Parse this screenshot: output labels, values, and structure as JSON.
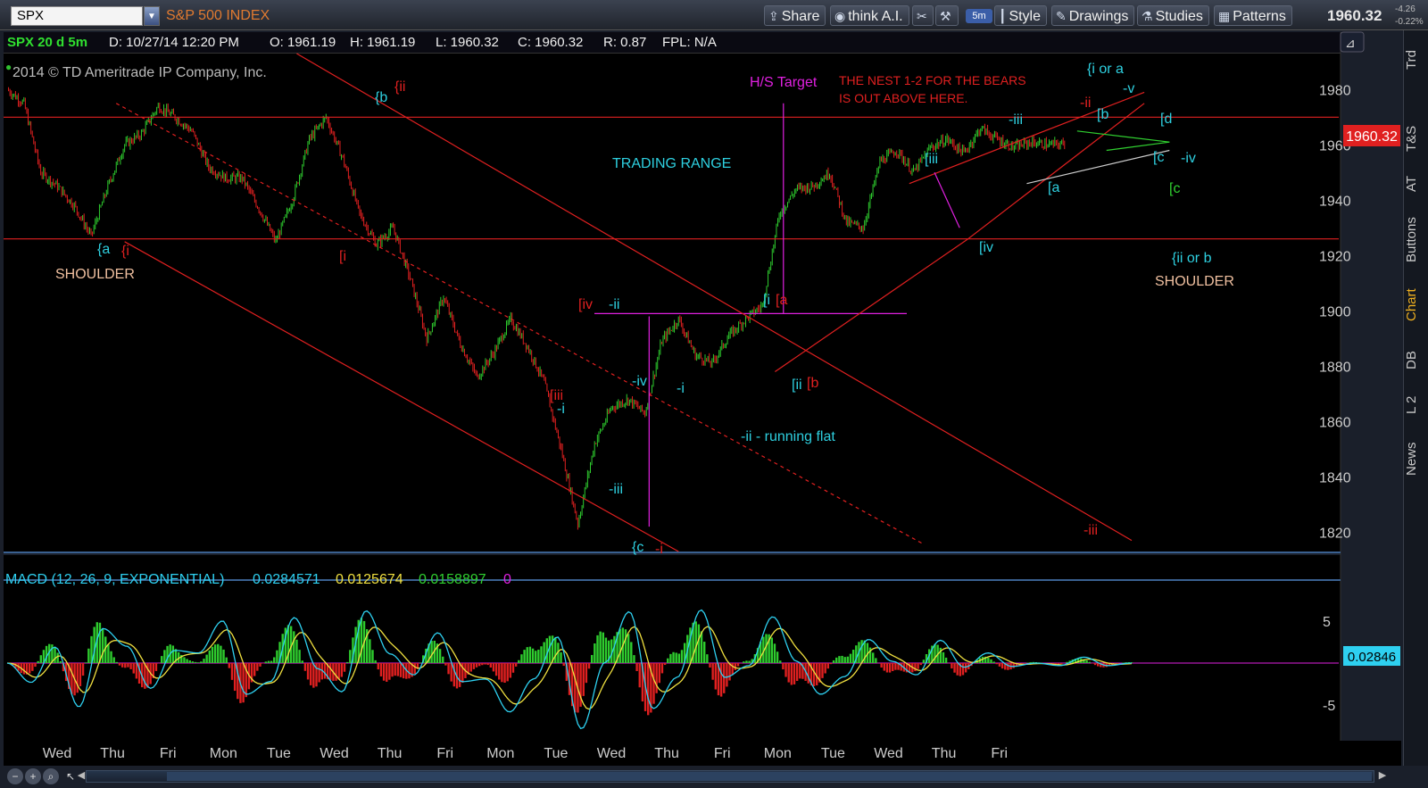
{
  "toolbar": {
    "symbol": "SPX",
    "index_name": "S&P 500 INDEX",
    "share": "Share",
    "think_ai": "think A.I.",
    "aggregation": "5m",
    "style": "Style",
    "drawings": "Drawings",
    "studies": "Studies",
    "patterns": "Patterns",
    "last_price": "1960.32",
    "net_change": "-4.26",
    "pct_change": "-0.22%"
  },
  "side_tabs": [
    "Trd",
    "T&S",
    "AT",
    "Buttons",
    "Chart",
    "DB",
    "L 2",
    "News"
  ],
  "info_bar": {
    "symbol": "SPX 20 d 5m",
    "date": "D: 10/27/14 12:20 PM",
    "open": "O: 1961.19",
    "high": "H: 1961.19",
    "low": "L: 1960.32",
    "close": "C: 1960.32",
    "range": "R: 0.87",
    "fpl": "FPL: N/A"
  },
  "copyright": "2014 © TD Ameritrade IP Company, Inc.",
  "colors": {
    "background": "#000000",
    "up": "#2ecc2e",
    "down": "#e02020",
    "annotation_cyan": "#2ed0e0",
    "annotation_red": "#e02020",
    "annotation_magenta": "#e020e0",
    "annotation_pink": "#f0c0a0",
    "macd_line": "#2ed0f0",
    "signal_line": "#f0e040",
    "price_badge": "#e02020"
  },
  "chart_data": [
    {
      "type": "candlestick",
      "title": "SPX 20 d 5m",
      "y_ticks": [
        1820,
        1840,
        1860,
        1880,
        1900,
        1920,
        1940,
        1960,
        1980
      ],
      "ylim": [
        1813,
        1993
      ],
      "last_value": "1960.32",
      "x_tick_labels": [
        "Wed",
        "Thu",
        "Fri",
        "Mon",
        "Tue",
        "Wed",
        "Thu",
        "Fri",
        "Mon",
        "Tue",
        "Wed",
        "Thu",
        "Fri",
        "Mon",
        "Tue",
        "Wed",
        "Thu",
        "Fri"
      ],
      "x": [
        0,
        4,
        8,
        12,
        16,
        20,
        24,
        28,
        32,
        36,
        40,
        44,
        48,
        52,
        56,
        60,
        64,
        68,
        72,
        76,
        80,
        84,
        88,
        92,
        96,
        100,
        104,
        108,
        112,
        116,
        120,
        124,
        128,
        132,
        136,
        140,
        144,
        148,
        152,
        156,
        160,
        164,
        168,
        172,
        176,
        180,
        184,
        188,
        192,
        196,
        200,
        204,
        208,
        212,
        216,
        220,
        224,
        228,
        232,
        236,
        240,
        244,
        248,
        252,
        256,
        260,
        264,
        268
      ],
      "close": [
        1980,
        1975,
        1950,
        1945,
        1938,
        1927,
        1945,
        1960,
        1964,
        1974,
        1970,
        1965,
        1952,
        1948,
        1948,
        1937,
        1925,
        1940,
        1962,
        1970,
        1955,
        1935,
        1924,
        1930,
        1912,
        1890,
        1905,
        1888,
        1876,
        1885,
        1897,
        1887,
        1874,
        1850,
        1823,
        1852,
        1865,
        1868,
        1863,
        1889,
        1897,
        1884,
        1881,
        1891,
        1897,
        1902,
        1935,
        1944,
        1945,
        1950,
        1932,
        1930,
        1954,
        1958,
        1950,
        1959,
        1962,
        1957,
        1966,
        1962,
        1959,
        1961,
        1960,
        1960.32
      ],
      "annotations": [
        "{a",
        "{i",
        "SHOULDER",
        "{b",
        "{ii",
        "[i",
        "TRADING RANGE",
        "[iv",
        "-ii",
        "[iii",
        "-i",
        "-iv",
        "-iii",
        "{c",
        "-i",
        "-i",
        "-ii - running flat",
        "[i",
        "[a",
        "[ii",
        "[b",
        "H/S Target",
        "THE NEST  1-2 FOR THE BEARS",
        "IS OUT ABOVE HERE.",
        "[iii",
        "[iv",
        "-iii",
        "[a",
        "-ii",
        "[b",
        "{i or a",
        "-v",
        "[d",
        "[c",
        "-iv",
        "[c",
        "{ii or b",
        "SHOULDER",
        "-iii"
      ]
    },
    {
      "type": "line",
      "title": "MACD (12, 26, 9, EXPONENTIAL)",
      "legend_values": [
        "0.0284571",
        "0.0125674",
        "0.0158897",
        "0"
      ],
      "y_ticks": [
        5,
        -5
      ],
      "ylim": [
        -9,
        9
      ],
      "last_value": "0.02846",
      "series": [
        {
          "name": "Value",
          "values": [
            0.0,
            -2.3,
            1.9,
            -5.2,
            4.1,
            2.0,
            -3.0,
            1.5,
            1.2,
            5.0,
            -3.7,
            -2.2,
            5.4,
            -0.7,
            -3.4,
            6.2,
            1.1,
            -1.4,
            3.6,
            -2.2,
            -1.9,
            -5.8,
            -1.9,
            3.1,
            -7.8,
            0.1,
            6.1,
            -5.4,
            -1.7,
            6.3,
            -1.7,
            -0.3,
            5.5,
            0.2,
            -3.7,
            -1.6,
            2.8,
            0.2,
            -1.4,
            2.7,
            -0.5,
            1.2,
            -0.4,
            0.0,
            -0.3,
            0.7,
            -0.3,
            0.0
          ]
        }
      ]
    }
  ]
}
